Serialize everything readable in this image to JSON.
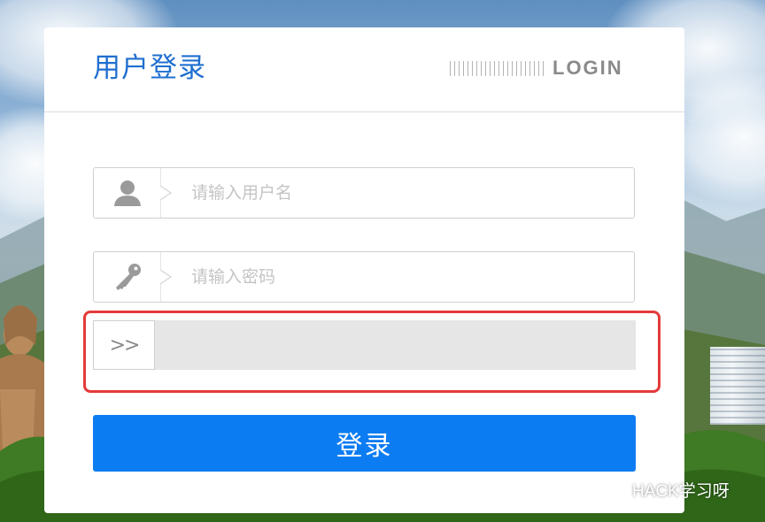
{
  "panel": {
    "title": "用户登录",
    "header_mark": "LOGIN"
  },
  "username": {
    "placeholder": "请输入用户名",
    "value": "",
    "icon": "user-icon"
  },
  "password": {
    "placeholder": "请输入密码",
    "value": "",
    "icon": "key-icon"
  },
  "slider_captcha": {
    "handle_glyph": ">>",
    "highlight_color": "#e43a3a"
  },
  "login_button": {
    "label": "登录",
    "color": "#0c7cf2"
  },
  "watermark": {
    "text": "HACK学习呀",
    "icon": "wechat-icon"
  },
  "colors": {
    "title": "#1f6fd0",
    "panel_bg": "#ffffff",
    "slider_track": "#e6e6e6"
  }
}
